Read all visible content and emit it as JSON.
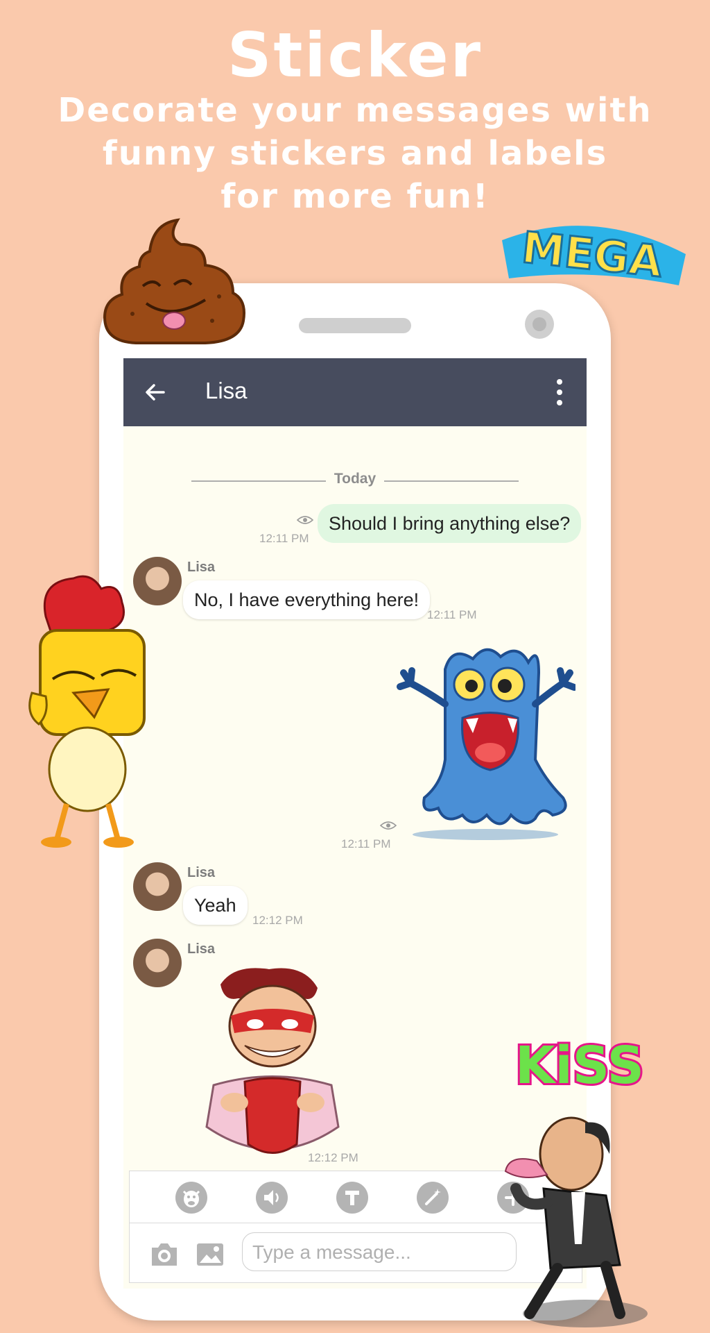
{
  "promo": {
    "title": "Sticker",
    "subtitle_lines": [
      "Decorate your messages with",
      "funny stickers and labels",
      "for more fun!"
    ]
  },
  "decor_stickers": {
    "mega": "MEGA",
    "kiss": "KiSS"
  },
  "chat": {
    "header": {
      "contact_name": "Lisa"
    },
    "day_separator": "Today",
    "messages": [
      {
        "direction": "out",
        "text": "Should I bring anything else?",
        "time": "12:11 PM",
        "seen": true
      },
      {
        "direction": "in",
        "sender": "Lisa",
        "text": "No, I have everything here!",
        "time": "12:11 PM"
      },
      {
        "direction": "out",
        "sticker": "blue-monster",
        "time": "12:11 PM",
        "seen": true
      },
      {
        "direction": "in",
        "sender": "Lisa",
        "text": "Yeah",
        "time": "12:12 PM"
      },
      {
        "direction": "in",
        "sender": "Lisa",
        "sticker": "superhero",
        "time": "12:12 PM"
      }
    ],
    "composer": {
      "placeholder": "Type a message...",
      "tools": [
        "sticker-face-icon",
        "sound-icon",
        "text-icon",
        "magic-icon",
        "add-icon"
      ]
    }
  },
  "colors": {
    "background": "#FAC9AC",
    "appbar": "#474C5E",
    "chat_bg": "#FEFDF1",
    "outgoing_bubble": "#E0F7E1"
  }
}
